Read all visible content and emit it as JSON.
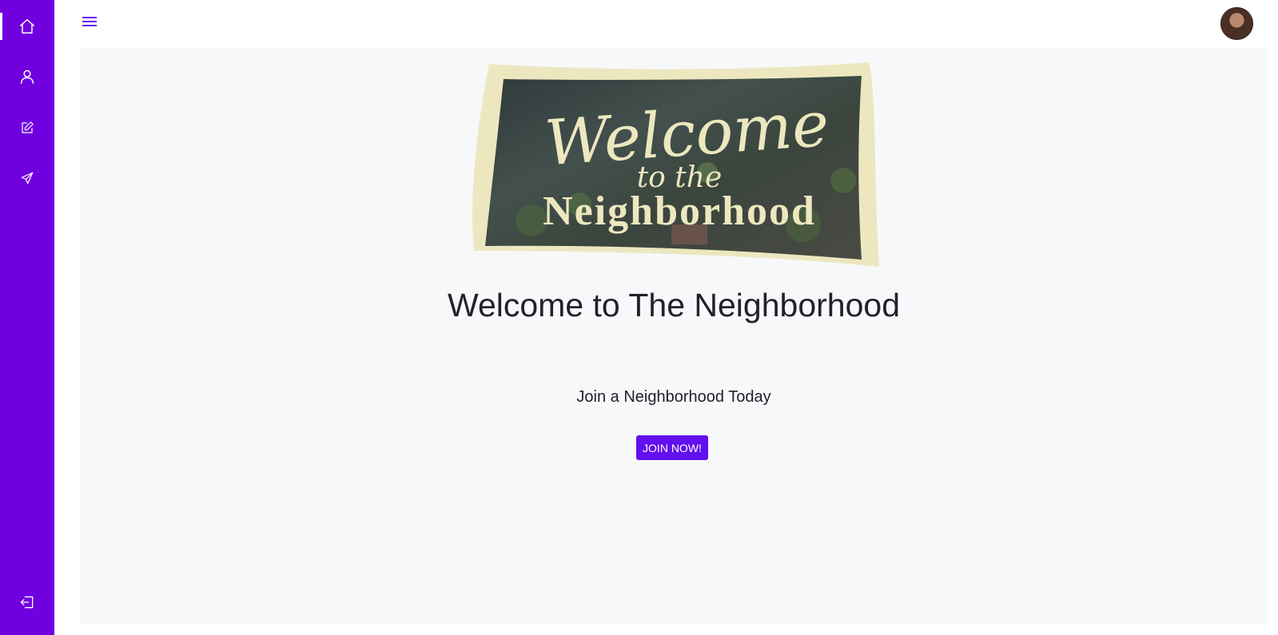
{
  "colors": {
    "accent": "#7000e0",
    "button": "#6210ee",
    "sign_cream": "#ece7bf"
  },
  "sidebar": {
    "items": [
      {
        "name": "home",
        "icon": "home-icon",
        "active": true
      },
      {
        "name": "profile",
        "icon": "user-icon",
        "active": false
      },
      {
        "name": "edit",
        "icon": "edit-icon",
        "active": false
      },
      {
        "name": "send",
        "icon": "send-icon",
        "active": false
      }
    ],
    "logout_icon": "logout-icon"
  },
  "header": {
    "menu_icon": "hamburger-icon",
    "avatar": "user-avatar"
  },
  "banner": {
    "line1": "Welcome",
    "line2": "to the",
    "line3": "Neighborhood"
  },
  "main": {
    "title": "Welcome to The Neighborhood",
    "subtitle": "Join a Neighborhood Today",
    "join_button": "JOIN NOW!"
  }
}
